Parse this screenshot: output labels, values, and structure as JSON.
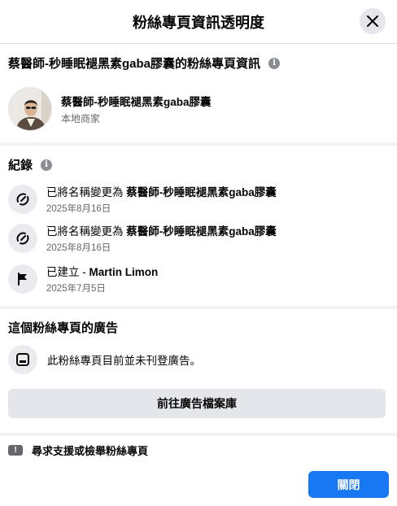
{
  "dialog": {
    "title": "粉絲專頁資訊透明度",
    "close_label": "關閉"
  },
  "page_info": {
    "heading": "蔡醫師-秒睡眠褪黑素gaba膠囊的粉絲專頁資訊",
    "page_name": "蔡醫師-秒睡眠褪黑素gaba膠囊",
    "category": "本地商家"
  },
  "history": {
    "heading": "紀錄",
    "items": [
      {
        "prefix": "已將名稱變更為 ",
        "value": "蔡醫師-秒睡眠褪黑素gaba膠囊",
        "date": "2025年8月16日",
        "icon": "rename-icon"
      },
      {
        "prefix": "已將名稱變更為 ",
        "value": "蔡醫師-秒睡眠褪黑素gaba膠囊",
        "date": "2025年8月16日",
        "icon": "rename-icon"
      },
      {
        "prefix": "已建立 - ",
        "value": "Martin Limon",
        "date": "2025年7月5日",
        "icon": "flag-icon"
      }
    ]
  },
  "ads": {
    "heading": "這個粉絲專頁的廣告",
    "status_text": "此粉絲專頁目前並未刊登廣告。",
    "library_button": "前往廣告檔案庫",
    "icon": "ad-icon"
  },
  "report": {
    "label": "尋求支援或檢舉粉絲專頁",
    "icon": "warning-icon"
  },
  "colors": {
    "primary": "#1877f2",
    "secondary_button": "#e4e6eb",
    "divider": "#f0f2f5",
    "muted_text": "#65676b"
  }
}
